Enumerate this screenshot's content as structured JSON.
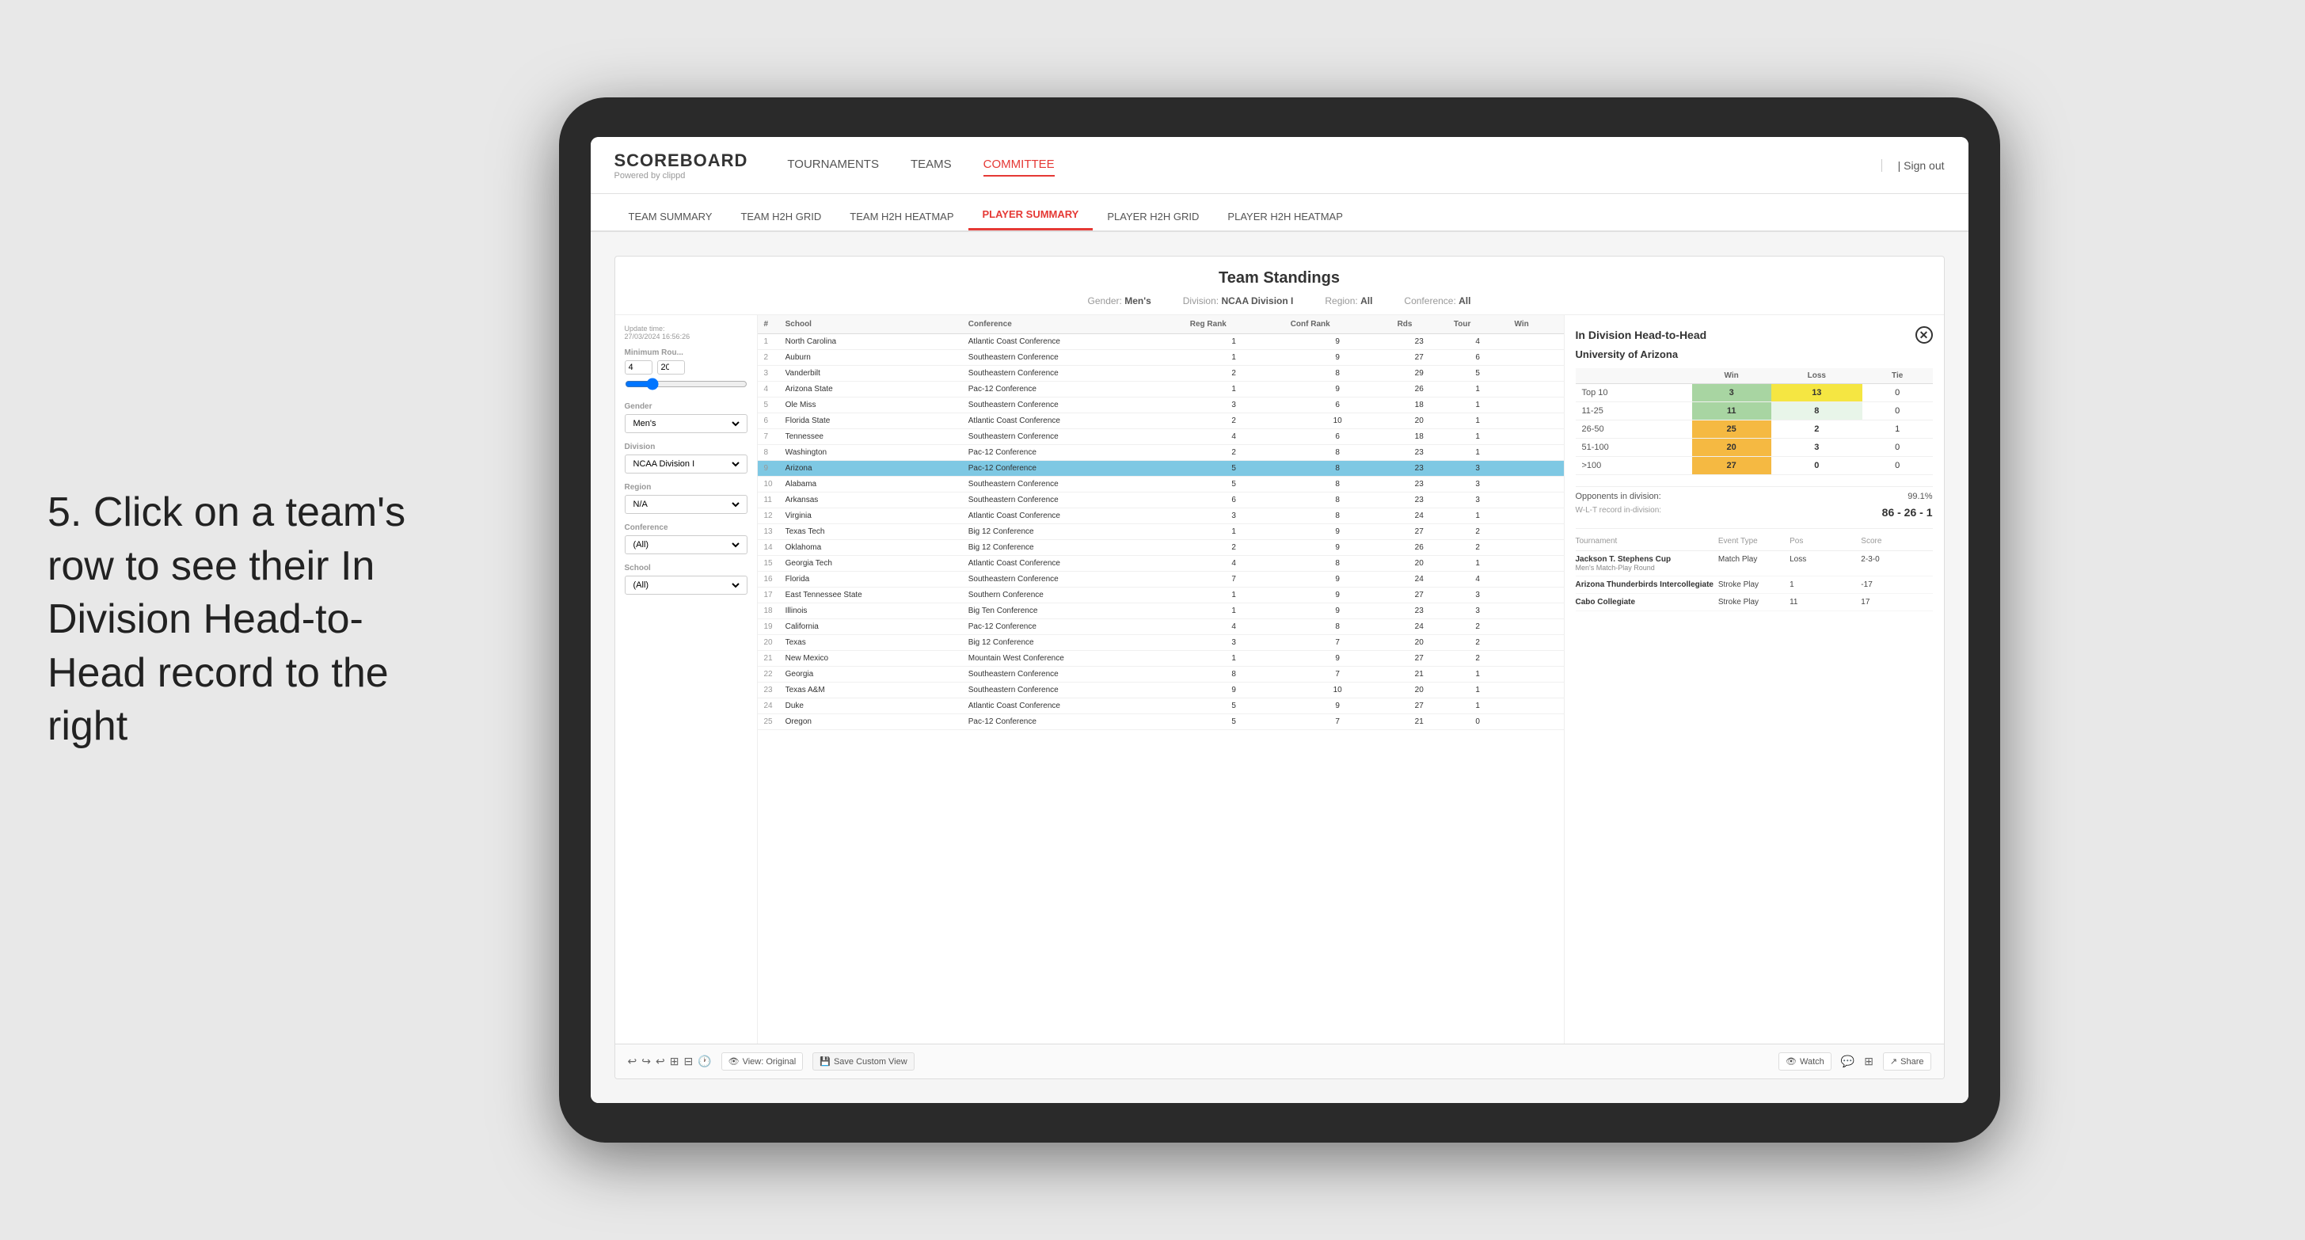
{
  "page": {
    "bg_color": "#e8e8e8"
  },
  "annotation": {
    "text": "5. Click on a team's row to see their In Division Head-to-Head record to the right"
  },
  "nav": {
    "logo": "SCOREBOARD",
    "logo_sub": "Powered by clippd",
    "items": [
      "TOURNAMENTS",
      "TEAMS",
      "COMMITTEE"
    ],
    "active_item": "COMMITTEE",
    "sign_out": "Sign out"
  },
  "subnav": {
    "items": [
      "TEAM SUMMARY",
      "TEAM H2H GRID",
      "TEAM H2H HEATMAP",
      "PLAYER SUMMARY",
      "PLAYER H2H GRID",
      "PLAYER H2H HEATMAP"
    ],
    "active_item": "PLAYER SUMMARY"
  },
  "content": {
    "update_time_label": "Update time:",
    "update_time": "27/03/2024 16:56:26",
    "card_title": "Team Standings",
    "gender_label": "Gender:",
    "gender_value": "Men's",
    "division_label": "Division:",
    "division_value": "NCAA Division I",
    "region_label": "Region:",
    "region_value": "All",
    "conference_label": "Conference:",
    "conference_value": "All"
  },
  "filters": {
    "min_rounds_label": "Minimum Rou...",
    "min_rounds_value": "4",
    "min_rounds_max": "20",
    "gender_label": "Gender",
    "gender_value": "Men's",
    "division_label": "Division",
    "division_value": "NCAA Division I",
    "region_label": "Region",
    "region_value": "N/A",
    "conference_label": "Conference",
    "conference_value": "(All)",
    "school_label": "School",
    "school_value": "(All)"
  },
  "table": {
    "headers": [
      "#",
      "School",
      "Conference",
      "Reg Rank",
      "Conf Rank",
      "Rds",
      "Tour",
      "Win"
    ],
    "rows": [
      {
        "rank": 1,
        "school": "North Carolina",
        "conference": "Atlantic Coast Conference",
        "reg_rank": 1,
        "conf_rank": 9,
        "rds": 23,
        "tour": 4,
        "win": ""
      },
      {
        "rank": 2,
        "school": "Auburn",
        "conference": "Southeastern Conference",
        "reg_rank": 1,
        "conf_rank": 9,
        "rds": 27,
        "tour": 6,
        "win": ""
      },
      {
        "rank": 3,
        "school": "Vanderbilt",
        "conference": "Southeastern Conference",
        "reg_rank": 2,
        "conf_rank": 8,
        "rds": 29,
        "tour": 5,
        "win": ""
      },
      {
        "rank": 4,
        "school": "Arizona State",
        "conference": "Pac-12 Conference",
        "reg_rank": 1,
        "conf_rank": 9,
        "rds": 26,
        "tour": 1,
        "win": ""
      },
      {
        "rank": 5,
        "school": "Ole Miss",
        "conference": "Southeastern Conference",
        "reg_rank": 3,
        "conf_rank": 6,
        "rds": 18,
        "tour": 1,
        "win": ""
      },
      {
        "rank": 6,
        "school": "Florida State",
        "conference": "Atlantic Coast Conference",
        "reg_rank": 2,
        "conf_rank": 10,
        "rds": 20,
        "tour": 1,
        "win": ""
      },
      {
        "rank": 7,
        "school": "Tennessee",
        "conference": "Southeastern Conference",
        "reg_rank": 4,
        "conf_rank": 6,
        "rds": 18,
        "tour": 1,
        "win": ""
      },
      {
        "rank": 8,
        "school": "Washington",
        "conference": "Pac-12 Conference",
        "reg_rank": 2,
        "conf_rank": 8,
        "rds": 23,
        "tour": 1,
        "win": ""
      },
      {
        "rank": 9,
        "school": "Arizona",
        "conference": "Pac-12 Conference",
        "reg_rank": 5,
        "conf_rank": 8,
        "rds": 23,
        "tour": 3,
        "win": "",
        "highlighted": true
      },
      {
        "rank": 10,
        "school": "Alabama",
        "conference": "Southeastern Conference",
        "reg_rank": 5,
        "conf_rank": 8,
        "rds": 23,
        "tour": 3,
        "win": ""
      },
      {
        "rank": 11,
        "school": "Arkansas",
        "conference": "Southeastern Conference",
        "reg_rank": 6,
        "conf_rank": 8,
        "rds": 23,
        "tour": 3,
        "win": ""
      },
      {
        "rank": 12,
        "school": "Virginia",
        "conference": "Atlantic Coast Conference",
        "reg_rank": 3,
        "conf_rank": 8,
        "rds": 24,
        "tour": 1,
        "win": ""
      },
      {
        "rank": 13,
        "school": "Texas Tech",
        "conference": "Big 12 Conference",
        "reg_rank": 1,
        "conf_rank": 9,
        "rds": 27,
        "tour": 2,
        "win": ""
      },
      {
        "rank": 14,
        "school": "Oklahoma",
        "conference": "Big 12 Conference",
        "reg_rank": 2,
        "conf_rank": 9,
        "rds": 26,
        "tour": 2,
        "win": ""
      },
      {
        "rank": 15,
        "school": "Georgia Tech",
        "conference": "Atlantic Coast Conference",
        "reg_rank": 4,
        "conf_rank": 8,
        "rds": 20,
        "tour": 1,
        "win": ""
      },
      {
        "rank": 16,
        "school": "Florida",
        "conference": "Southeastern Conference",
        "reg_rank": 7,
        "conf_rank": 9,
        "rds": 24,
        "tour": 4,
        "win": ""
      },
      {
        "rank": 17,
        "school": "East Tennessee State",
        "conference": "Southern Conference",
        "reg_rank": 1,
        "conf_rank": 9,
        "rds": 27,
        "tour": 3,
        "win": ""
      },
      {
        "rank": 18,
        "school": "Illinois",
        "conference": "Big Ten Conference",
        "reg_rank": 1,
        "conf_rank": 9,
        "rds": 23,
        "tour": 3,
        "win": ""
      },
      {
        "rank": 19,
        "school": "California",
        "conference": "Pac-12 Conference",
        "reg_rank": 4,
        "conf_rank": 8,
        "rds": 24,
        "tour": 2,
        "win": ""
      },
      {
        "rank": 20,
        "school": "Texas",
        "conference": "Big 12 Conference",
        "reg_rank": 3,
        "conf_rank": 7,
        "rds": 20,
        "tour": 2,
        "win": ""
      },
      {
        "rank": 21,
        "school": "New Mexico",
        "conference": "Mountain West Conference",
        "reg_rank": 1,
        "conf_rank": 9,
        "rds": 27,
        "tour": 2,
        "win": ""
      },
      {
        "rank": 22,
        "school": "Georgia",
        "conference": "Southeastern Conference",
        "reg_rank": 8,
        "conf_rank": 7,
        "rds": 21,
        "tour": 1,
        "win": ""
      },
      {
        "rank": 23,
        "school": "Texas A&M",
        "conference": "Southeastern Conference",
        "reg_rank": 9,
        "conf_rank": 10,
        "rds": 20,
        "tour": 1,
        "win": ""
      },
      {
        "rank": 24,
        "school": "Duke",
        "conference": "Atlantic Coast Conference",
        "reg_rank": 5,
        "conf_rank": 9,
        "rds": 27,
        "tour": 1,
        "win": ""
      },
      {
        "rank": 25,
        "school": "Oregon",
        "conference": "Pac-12 Conference",
        "reg_rank": 5,
        "conf_rank": 7,
        "rds": 21,
        "tour": 0,
        "win": ""
      }
    ]
  },
  "h2h": {
    "title": "In Division Head-to-Head",
    "team_name": "University of Arizona",
    "col_win": "Win",
    "col_loss": "Loss",
    "col_tie": "Tie",
    "rows": [
      {
        "range": "Top 10",
        "win": 3,
        "loss": 13,
        "tie": 0,
        "win_color": "cell-green",
        "loss_color": "cell-yellow"
      },
      {
        "range": "11-25",
        "win": 11,
        "loss": 8,
        "tie": 0,
        "win_color": "cell-green",
        "loss_color": "cell-light"
      },
      {
        "range": "26-50",
        "win": 25,
        "loss": 2,
        "tie": 1,
        "win_color": "cell-orange",
        "loss_color": ""
      },
      {
        "range": "51-100",
        "win": 20,
        "loss": 3,
        "tie": 0,
        "win_color": "cell-orange",
        "loss_color": ""
      },
      {
        "range": ">100",
        "win": 27,
        "loss": 0,
        "tie": 0,
        "win_color": "cell-orange",
        "loss_color": ""
      }
    ],
    "opponents_label": "Opponents in division:",
    "opponents_value": "99.1%",
    "record_label": "W-L-T record in-division:",
    "record_value": "86 - 26 - 1",
    "tournaments": [
      {
        "name": "Jackson T. Stephens Cup",
        "sub": "Men's Match-Play Round",
        "event_type": "Match Play",
        "pos": "Loss",
        "score": "2-3-0"
      },
      {
        "name": "Arizona Thunderbirds Intercollegiate",
        "sub": "",
        "event_type": "Stroke Play",
        "pos": "1",
        "score": "-17"
      },
      {
        "name": "Cabo Collegiate",
        "sub": "",
        "event_type": "Stroke Play",
        "pos": "11",
        "score": "17"
      }
    ],
    "tourn_col_tournament": "Tournament",
    "tourn_col_event_type": "Event Type",
    "tourn_col_pos": "Pos",
    "tourn_col_score": "Score"
  },
  "toolbar": {
    "undo": "↩",
    "redo": "↪",
    "view_original": "View: Original",
    "save_custom": "Save Custom View",
    "watch": "Watch",
    "share": "Share"
  }
}
